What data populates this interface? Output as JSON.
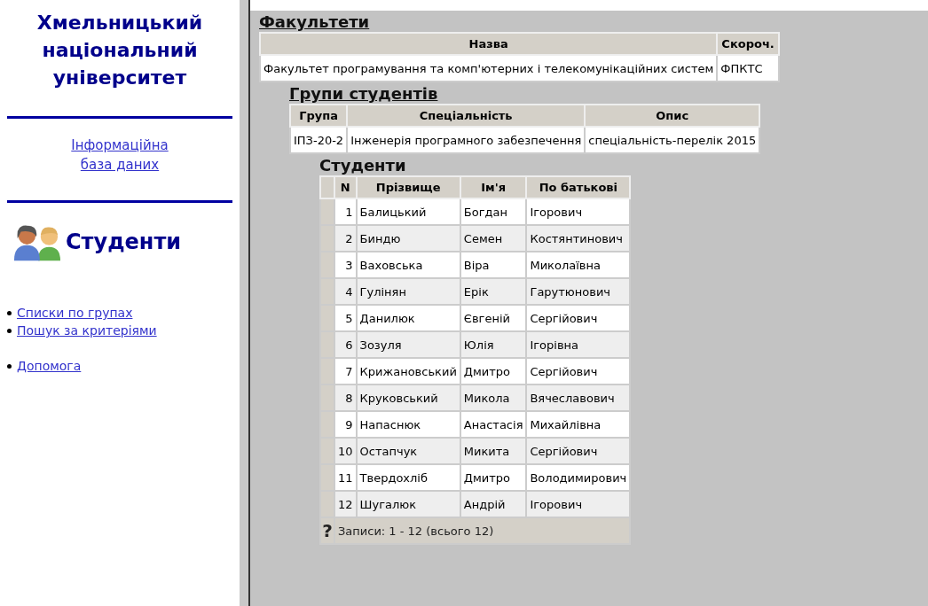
{
  "sidebar": {
    "university": "Хмельницький національний університет",
    "db_link": "Інформаційна база даних",
    "section_title": "Студенти",
    "link_groups": [
      [
        "Списки по групах",
        "Пошук за критеріями"
      ],
      [
        "Допомога"
      ]
    ]
  },
  "faculties": {
    "title": "Факультети",
    "columns": [
      "Назва",
      "Скороч."
    ],
    "rows": [
      [
        "Факультет програмування та комп'ютерних і телекомунікаційних систем",
        "ФПКТС"
      ]
    ]
  },
  "groups": {
    "title": "Групи студентів",
    "columns": [
      "Група",
      "Спеціальність",
      "Опис"
    ],
    "rows": [
      [
        "ІПЗ-20-2",
        "Інженерія програмного забезпечення",
        "спеціальність-перелік 2015"
      ]
    ]
  },
  "students": {
    "title": "Студенти",
    "columns": [
      "N",
      "Прізвище",
      "Ім'я",
      "По батькові"
    ],
    "rows": [
      [
        "1",
        "Балицький",
        "Богдан",
        "Ігорович"
      ],
      [
        "2",
        "Биндю",
        "Семен",
        "Костянтинович"
      ],
      [
        "3",
        "Ваховська",
        "Віра",
        "Миколаївна"
      ],
      [
        "4",
        "Гулінян",
        "Ерік",
        "Гарутюнович"
      ],
      [
        "5",
        "Данилюк",
        "Євгеній",
        "Сергійович"
      ],
      [
        "6",
        "Зозуля",
        "Юлія",
        "Ігорівна"
      ],
      [
        "7",
        "Крижановський",
        "Дмитро",
        "Сергійович"
      ],
      [
        "8",
        "Круковський",
        "Микола",
        "Вячеславович"
      ],
      [
        "9",
        "Напаснюк",
        "Анастасія",
        "Михайлівна"
      ],
      [
        "10",
        "Остапчук",
        "Микита",
        "Сергійович"
      ],
      [
        "11",
        "Твердохліб",
        "Дмитро",
        "Володимирович"
      ],
      [
        "12",
        "Шугалюк",
        "Андрій",
        "Ігорович"
      ]
    ],
    "help": "?",
    "footer": "Записи: 1 - 12 (всього 12)"
  }
}
